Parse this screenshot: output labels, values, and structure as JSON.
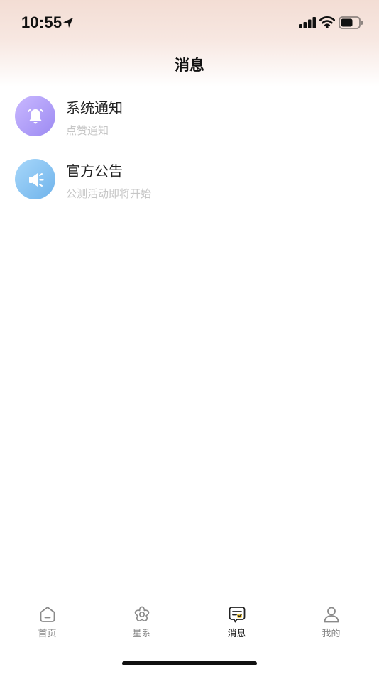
{
  "status_bar": {
    "time": "10:55"
  },
  "header": {
    "title": "消息"
  },
  "messages": [
    {
      "title": "系统通知",
      "subtitle": "点赞通知",
      "icon": "bell-icon",
      "color": "#a898f6"
    },
    {
      "title": "官方公告",
      "subtitle": "公测活动即将开始",
      "icon": "megaphone-icon",
      "color": "#7dbbee"
    }
  ],
  "tab_bar": {
    "tabs": [
      {
        "label": "首页",
        "icon": "home-icon",
        "active": false
      },
      {
        "label": "星系",
        "icon": "flower-icon",
        "active": false
      },
      {
        "label": "消息",
        "icon": "message-icon",
        "active": true
      },
      {
        "label": "我的",
        "icon": "user-icon",
        "active": false
      }
    ],
    "active_color": "#f6d04d"
  }
}
